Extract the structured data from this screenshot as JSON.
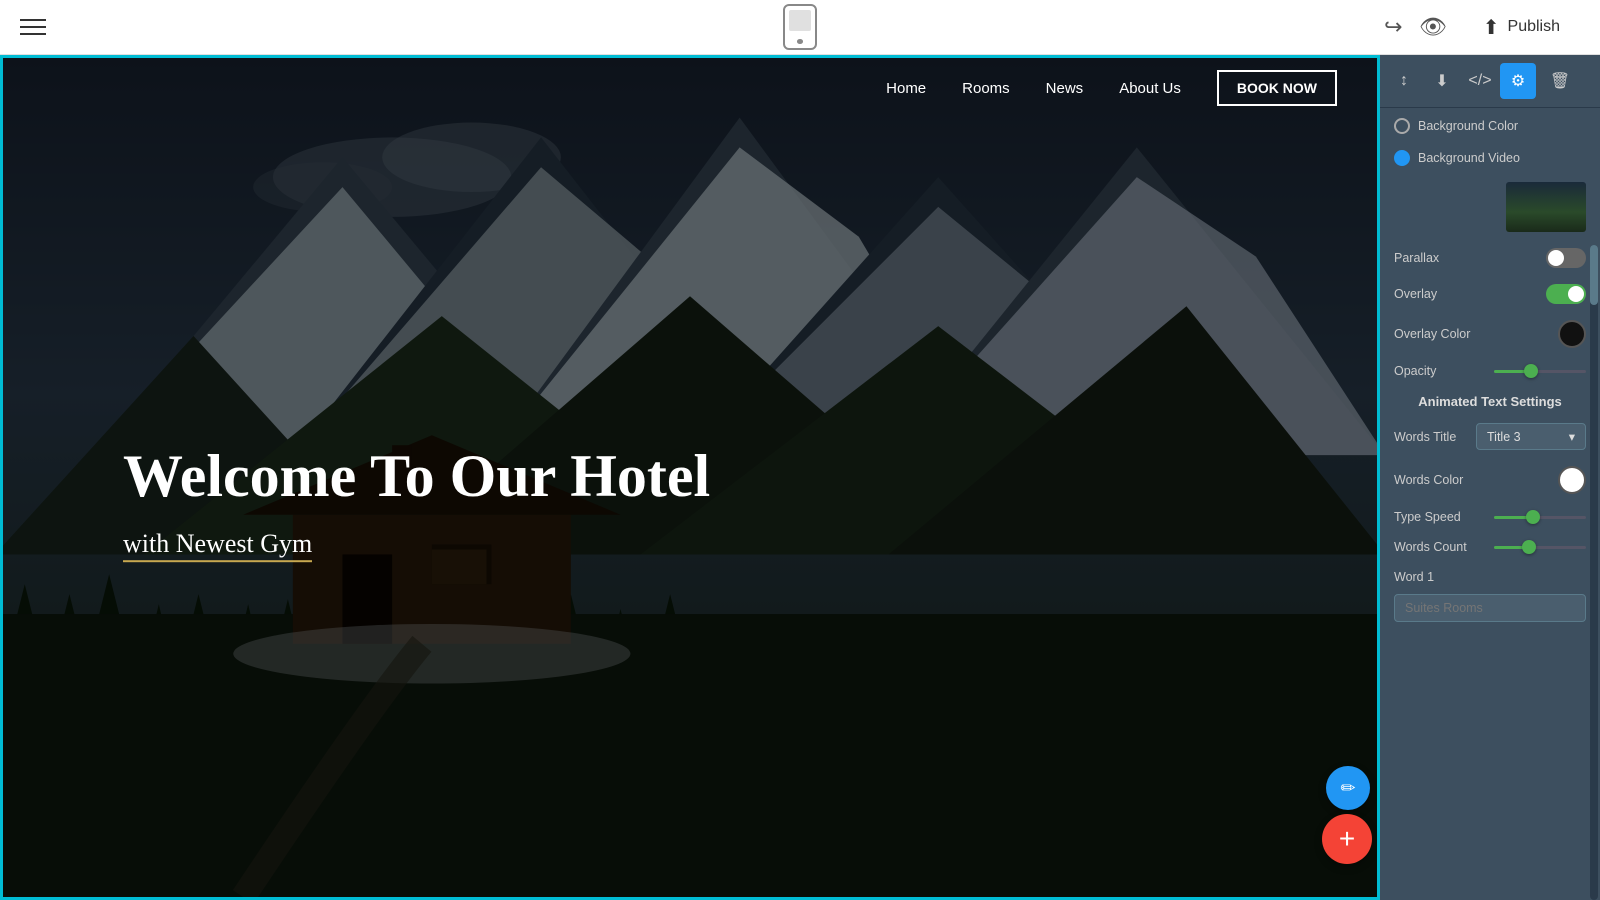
{
  "toolbar": {
    "publish_label": "Publish"
  },
  "nav": {
    "links": [
      "Home",
      "Rooms",
      "News",
      "About Us"
    ],
    "book_label": "BOOK NOW"
  },
  "hero": {
    "title": "Welcome To Our Hotel",
    "subtitle_prefix": "with ",
    "subtitle_highlight": "Newest Gym"
  },
  "panel": {
    "bg_color_label": "Background Color",
    "bg_video_label": "Background Video",
    "parallax_label": "Parallax",
    "overlay_label": "Overlay",
    "overlay_color_label": "Overlay Color",
    "opacity_label": "Opacity",
    "animated_text_heading": "Animated Text Settings",
    "words_title_label": "Words Title",
    "words_title_value": "Title 3",
    "words_color_label": "Words Color",
    "type_speed_label": "Type Speed",
    "words_count_label": "Words Count",
    "word_1_label": "Word 1",
    "word_1_placeholder": "Suites Rooms",
    "parallax_on": false,
    "overlay_on": true,
    "opacity_percent": 40,
    "type_speed_percent": 42,
    "words_count_percent": 38
  },
  "tools": {
    "up_down": "↕",
    "download": "↓",
    "code": "</>",
    "settings": "⚙",
    "trash": "🗑"
  }
}
